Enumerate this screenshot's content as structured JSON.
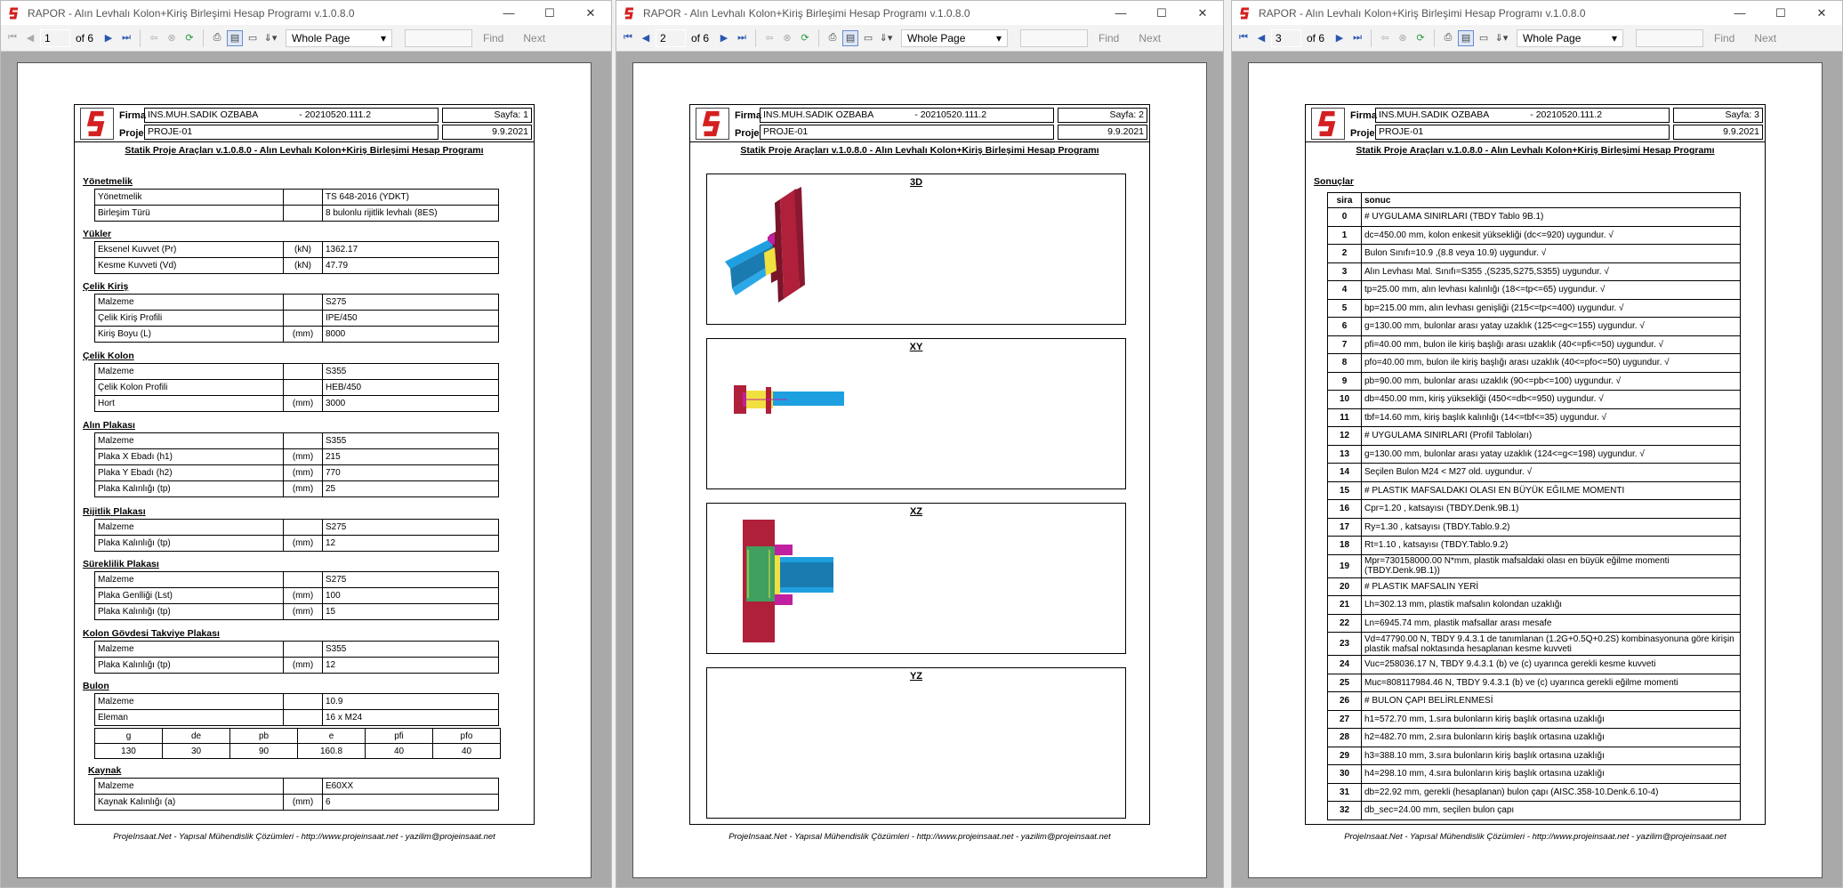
{
  "windows": [
    {
      "title": "RAPOR - Alın Levhalı Kolon+Kiriş Birleşimi Hesap Programı v.1.0.8.0",
      "page": "1",
      "of": "of 6"
    },
    {
      "title": "RAPOR - Alın Levhalı Kolon+Kiriş Birleşimi Hesap Programı v.1.0.8.0",
      "page": "2",
      "of": "of 6"
    },
    {
      "title": "RAPOR - Alın Levhalı Kolon+Kiriş Birleşimi Hesap Programı v.1.0.8.0",
      "page": "3",
      "of": "of 6"
    }
  ],
  "toolbar": {
    "zoom": "Whole Page",
    "find": "Find",
    "next": "Next"
  },
  "header": {
    "firma_label": "Firma",
    "proje_label": "Proje",
    "firma_value": "INS.MUH.SADIK OZBABA",
    "firma_code": "- 20210520.111.2",
    "proje_value": "PROJE-01",
    "date": "9.9.2021",
    "sayfa1": "Sayfa: 1",
    "sayfa2": "Sayfa: 2",
    "sayfa3": "Sayfa: 3",
    "subtitle": "Statik Proje Araçları v.1.0.8.0 - Alın Levhalı Kolon+Kiriş Birleşimi Hesap Programı"
  },
  "footer": "ProjeInsaat.Net - Yapısal Mühendislik Çözümleri - http://www.projeinsaat.net - yazilim@projeinsaat.net",
  "sections": [
    {
      "title": "Yönetmelik",
      "rows": [
        {
          "k": "Yönetmelik",
          "u": "",
          "v": "TS 648-2016 (YDKT)"
        },
        {
          "k": "Birleşim Türü",
          "u": "",
          "v": "8 bulonlu rijitlik levhalı (8ES)"
        }
      ]
    },
    {
      "title": "Yükler",
      "rows": [
        {
          "k": "Eksenel Kuvvet (Pr)",
          "u": "(kN)",
          "v": "1362.17"
        },
        {
          "k": "Kesme Kuvveti (Vd)",
          "u": "(kN)",
          "v": "47.79"
        }
      ]
    },
    {
      "title": "Çelik Kiriş",
      "rows": [
        {
          "k": "Malzeme",
          "u": "",
          "v": "S275"
        },
        {
          "k": "Çelik Kiriş Profili",
          "u": "",
          "v": "IPE/450"
        },
        {
          "k": "Kiriş Boyu (L)",
          "u": "(mm)",
          "v": "8000"
        }
      ]
    },
    {
      "title": "Çelik Kolon",
      "rows": [
        {
          "k": "Malzeme",
          "u": "",
          "v": "S355"
        },
        {
          "k": "Çelik Kolon Profili",
          "u": "",
          "v": "HEB/450"
        },
        {
          "k": "Hort",
          "u": "(mm)",
          "v": "3000"
        }
      ]
    },
    {
      "title": "Alın Plakası",
      "rows": [
        {
          "k": "Malzeme",
          "u": "",
          "v": "S355"
        },
        {
          "k": "Plaka X Ebadı (h1)",
          "u": "(mm)",
          "v": "215"
        },
        {
          "k": "Plaka Y Ebadı (h2)",
          "u": "(mm)",
          "v": "770"
        },
        {
          "k": "Plaka Kalınlığı (tp)",
          "u": "(mm)",
          "v": "25"
        }
      ]
    },
    {
      "title": "Rijitlik Plakası",
      "rows": [
        {
          "k": "Malzeme",
          "u": "",
          "v": "S275"
        },
        {
          "k": "Plaka Kalınlığı (tp)",
          "u": "(mm)",
          "v": "12"
        }
      ]
    },
    {
      "title": "Süreklilik Plakası",
      "rows": [
        {
          "k": "Malzeme",
          "u": "",
          "v": "S275"
        },
        {
          "k": "Plaka Genlliği (Lst)",
          "u": "(mm)",
          "v": "100"
        },
        {
          "k": "Plaka Kalınlığı (tp)",
          "u": "(mm)",
          "v": "15"
        }
      ]
    },
    {
      "title": "Kolon Gövdesi Takviye Plakası",
      "rows": [
        {
          "k": "Malzeme",
          "u": "",
          "v": "S355"
        },
        {
          "k": "Plaka Kalınlığı (tp)",
          "u": "(mm)",
          "v": "12"
        }
      ]
    },
    {
      "title": "Bulon",
      "rows": [
        {
          "k": "Malzeme",
          "u": "",
          "v": "10.9"
        },
        {
          "k": "Eleman",
          "u": "",
          "v": "16 x M24"
        }
      ]
    },
    {
      "title": "Kaynak",
      "rows": [
        {
          "k": "Malzeme",
          "u": "",
          "v": "E60XX"
        },
        {
          "k": "Kaynak Kalınlığı (a)",
          "u": "(mm)",
          "v": "6"
        }
      ]
    }
  ],
  "bolt_table": {
    "headers": [
      "g",
      "de",
      "pb",
      "e",
      "pfi",
      "pfo"
    ],
    "values": [
      "130",
      "30",
      "90",
      "160.8",
      "40",
      "40"
    ]
  },
  "figures": [
    "3D",
    "XY",
    "XZ",
    "YZ"
  ],
  "results": {
    "title": "Sonuçlar",
    "headers": [
      "sira",
      "sonuc"
    ],
    "rows": [
      [
        "0",
        "# UYGULAMA SINIRLARI (TBDY Tablo 9B.1)"
      ],
      [
        "1",
        "dc=450.00 mm, kolon enkesit yüksekliği (dc<=920) uygundur. √"
      ],
      [
        "2",
        "Bulon Sınıfı=10.9 ,(8.8 veya 10.9) uygundur. √"
      ],
      [
        "3",
        "Alın Levhası Mal. Sınıfı=S355 ,(S235,S275,S355) uygundur. √"
      ],
      [
        "4",
        "tp=25.00 mm, alın levhası kalınlığı (18<=tp<=65) uygundur. √"
      ],
      [
        "5",
        "bp=215.00 mm, alın levhası genişliği (215<=tp<=400) uygundur. √"
      ],
      [
        "6",
        "g=130.00 mm, bulonlar arası yatay uzaklık (125<=g<=155) uygundur. √"
      ],
      [
        "7",
        "pfi=40.00 mm, bulon ile kiriş başlığı arası uzaklık (40<=pfi<=50) uygundur. √"
      ],
      [
        "8",
        "pfo=40.00 mm, bulon ile kiriş başlığı arası uzaklık (40<=pfo<=50) uygundur. √"
      ],
      [
        "9",
        "pb=90.00 mm, bulonlar arası uzaklık (90<=pb<=100) uygundur. √"
      ],
      [
        "10",
        "db=450.00 mm, kiriş yüksekliği (450<=db<=950) uygundur. √"
      ],
      [
        "11",
        "tbf=14.60 mm, kiriş başlık kalınlığı (14<=tbf<=35) uygundur. √"
      ],
      [
        "12",
        "# UYGULAMA SINIRLARI (Profil Tabloları)"
      ],
      [
        "13",
        "g=130.00 mm, bulonlar arası yatay uzaklık (124<=g<=198) uygundur. √"
      ],
      [
        "14",
        "Seçilen Bulon M24 < M27 old. uygundur. √"
      ],
      [
        "15",
        "# PLASTIK MAFSALDAKI OLASI EN BÜYÜK EĞILME MOMENTI"
      ],
      [
        "16",
        "Cpr=1.20 , katsayısı (TBDY.Denk.9B.1)"
      ],
      [
        "17",
        "Ry=1.30 , katsayısı (TBDY.Tablo.9.2)"
      ],
      [
        "18",
        "Rt=1.10 , katsayısı (TBDY.Tablo.9.2)"
      ],
      [
        "19",
        "Mpr=730158000.00 N*mm, plastik mafsaldaki olası en büyük eğilme momenti (TBDY.Denk.9B.1))"
      ],
      [
        "20",
        "# PLASTIK MAFSALIN YERİ"
      ],
      [
        "21",
        "Lh=302.13 mm, plastik mafsalın kolondan uzaklığı"
      ],
      [
        "22",
        "Ln=6945.74 mm, plastik mafsallar arası mesafe"
      ],
      [
        "23",
        "Vd=47790.00 N, TBDY 9.4.3.1 de tanımlanan (1.2G+0.5Q+0.2S) kombinasyonuna göre kirişin plastik mafsal noktasında hesaplanan kesme kuvveti"
      ],
      [
        "24",
        "Vuc=258036.17 N, TBDY 9.4.3.1 (b) ve (c) uyarınca gerekli kesme kuvveti"
      ],
      [
        "25",
        "Muc=808117984.46 N, TBDY 9.4.3.1 (b) ve (c) uyarınca gerekli eğilme momenti"
      ],
      [
        "26",
        "# BULON ÇAPI BELİRLENMESİ"
      ],
      [
        "27",
        "h1=572.70 mm, 1.sıra bulonların kiriş başlık ortasına uzaklığı"
      ],
      [
        "28",
        "h2=482.70 mm, 2.sıra bulonların kiriş başlık ortasına uzaklığı"
      ],
      [
        "29",
        "h3=388.10 mm, 3.sıra bulonların kiriş başlık ortasına uzaklığı"
      ],
      [
        "30",
        "h4=298.10 mm, 4.sıra bulonların kiriş başlık ortasına uzaklığı"
      ],
      [
        "31",
        "db=22.92 mm, gerekli (hesaplanan) bulon çapı (AISC.358-10.Denk.6.10-4)"
      ],
      [
        "32",
        "db_sec=24.00 mm, seçilen bulon çapı"
      ]
    ]
  },
  "colors": {
    "logo_red": "#d42020",
    "column_red": "#b0203a",
    "beam_blue": "#1ea0e0",
    "plate_yellow": "#f0e040",
    "plate_green": "#40a060",
    "plate_magenta": "#c020a0",
    "viewport": "#a9a9a9"
  }
}
